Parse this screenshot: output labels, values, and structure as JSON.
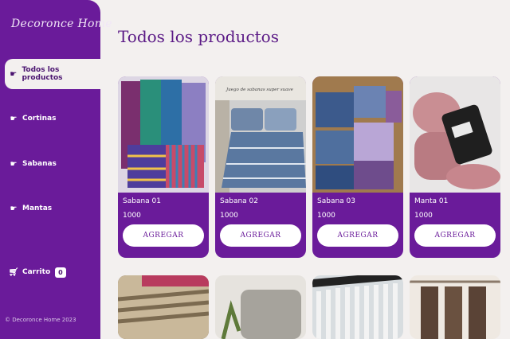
{
  "sidebar": {
    "logo": "Decoronce Home",
    "items": [
      {
        "label": "Todos los productos",
        "icon": "hand-pointer-icon"
      },
      {
        "label": "Cortinas",
        "icon": "hand-pointer-icon"
      },
      {
        "label": "Sabanas",
        "icon": "hand-pointer-icon"
      },
      {
        "label": "Mantas",
        "icon": "hand-pointer-icon"
      }
    ],
    "cart": {
      "label": "Carrito",
      "count": "0",
      "icon": "cart-icon"
    },
    "footer": "© Decoronce Home 2023"
  },
  "main": {
    "title": "Todos los productos",
    "products": [
      {
        "name": "Sabana 01",
        "price": "1000",
        "button": "AGREGAR"
      },
      {
        "name": "Sabana 02",
        "price": "1000",
        "button": "AGREGAR"
      },
      {
        "name": "Sabana 03",
        "price": "1000",
        "button": "AGREGAR"
      },
      {
        "name": "Manta 01",
        "price": "1000",
        "button": "AGREGAR"
      }
    ],
    "product_image_caption": "Juego de sabanas super suave"
  },
  "colors": {
    "accent": "#6a1b9a",
    "background": "#f3f0ef"
  }
}
